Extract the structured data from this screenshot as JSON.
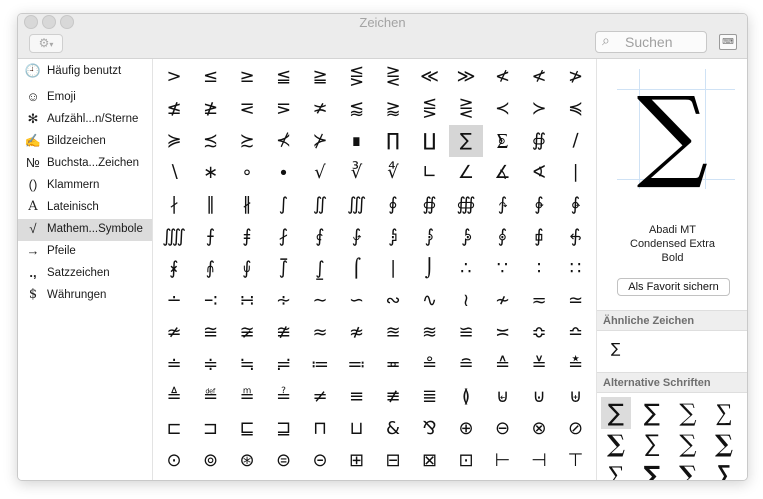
{
  "window": {
    "title": "Zeichen"
  },
  "toolbar": {
    "gear_icon": "gear-icon",
    "search_placeholder": "Suchen",
    "keyboard_icon": "keyboard-viewer-icon"
  },
  "sidebar": {
    "items": [
      {
        "icon": "🕘",
        "label": "Häufig benutzt"
      },
      {
        "icon": "☺",
        "label": "Emoji"
      },
      {
        "icon": "✻",
        "label": "Aufzähl...n/Sterne"
      },
      {
        "icon": "✍",
        "label": "Bildzeichen"
      },
      {
        "icon": "№",
        "label": "Buchsta...Zeichen"
      },
      {
        "icon": "()",
        "label": "Klammern"
      },
      {
        "icon": "A",
        "label": "Lateinisch"
      },
      {
        "icon": "√",
        "label": "Mathem...Symbole"
      },
      {
        "icon": "→",
        "label": "Pfeile"
      },
      {
        "icon": ".,",
        "label": "Satzzeichen"
      },
      {
        "icon": "$",
        "label": "Währungen"
      }
    ],
    "selected": "Mathem...Symbole"
  },
  "grid": {
    "rows": [
      [
        ">",
        "≤",
        "≥",
        "≦",
        "≧",
        "⋚",
        "⋛",
        "≪",
        "≫",
        "≮",
        "≮",
        "≯"
      ],
      [
        "≰",
        "≱",
        "⋜",
        "⋝",
        "≭",
        "⪅",
        "⪆",
        "⋚",
        "⋛",
        "≺",
        "≻",
        "≼"
      ],
      [
        "≽",
        "≾",
        "≿",
        "⊀",
        "⊁",
        "∎",
        "∏",
        "∐",
        "∑",
        "⨊",
        "∯",
        "∕"
      ],
      [
        "∖",
        "∗",
        "∘",
        "∙",
        "√",
        "∛",
        "∜",
        "∟",
        "∠",
        "∡",
        "∢",
        "∣"
      ],
      [
        "∤",
        "∥",
        "∦",
        "∫",
        "∬",
        "∭",
        "∮",
        "∯",
        "∰",
        "∱",
        "∲",
        "∳"
      ],
      [
        "⨌",
        "⨍",
        "⨎",
        "⨏",
        "⨐",
        "⨑",
        "⨒",
        "⨓",
        "⨔",
        "⨕",
        "⨖",
        "⨗"
      ],
      [
        "⨘",
        "⨙",
        "⨚",
        "⨛",
        "⨜",
        "⌠",
        "∣",
        "⌡",
        "∴",
        "∵",
        "∶",
        "∷"
      ],
      [
        "∸",
        "∹",
        "∺",
        "∻",
        "∼",
        "∽",
        "∾",
        "∿",
        "≀",
        "≁",
        "≂",
        "≃"
      ],
      [
        "≄",
        "≅",
        "≆",
        "≇",
        "≈",
        "≉",
        "≊",
        "≋",
        "≌",
        "≍",
        "≎",
        "≏"
      ],
      [
        "≐",
        "≑",
        "≒",
        "≓",
        "≔",
        "≕",
        "≖",
        "≗",
        "≘",
        "≙",
        "≚",
        "≛"
      ],
      [
        "≜",
        "≝",
        "≞",
        "≟",
        "≠",
        "≡",
        "≢",
        "≣",
        "≬",
        "⊌",
        "⊍",
        "⊎"
      ],
      [
        "⊏",
        "⊐",
        "⊑",
        "⊒",
        "⊓",
        "⊔",
        "&",
        "⅋",
        "⊕",
        "⊖",
        "⊗",
        "⊘"
      ],
      [
        "⊙",
        "⊚",
        "⊛",
        "⊜",
        "⊝",
        "⊞",
        "⊟",
        "⊠",
        "⊡",
        "⊢",
        "⊣",
        "⊤"
      ]
    ],
    "selected": "∑"
  },
  "preview": {
    "char": "∑",
    "font_name_lines": [
      "Abadi MT",
      "Condensed Extra",
      "Bold"
    ],
    "fav_button": "Als Favorit sichern"
  },
  "similar": {
    "header": "Ähnliche Zeichen",
    "chars": [
      "∑"
    ]
  },
  "alternatives": {
    "header": "Alternative Schriften",
    "chars": [
      "∑",
      "∑",
      "∑",
      "∑",
      "∑",
      "∑",
      "∑",
      "∑",
      "∑",
      "∑",
      "∑",
      "∑"
    ]
  }
}
